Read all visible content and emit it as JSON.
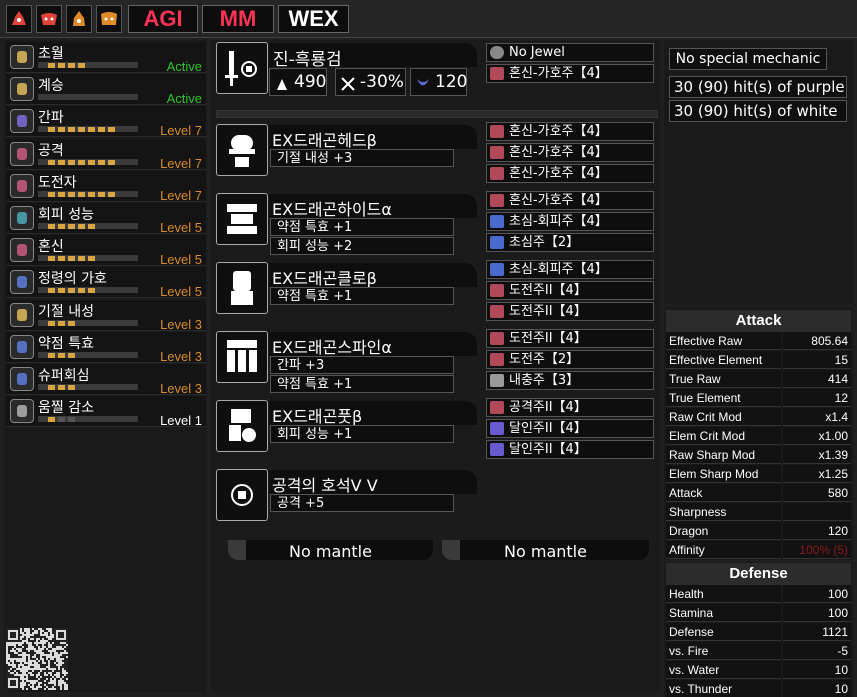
{
  "toolbar": {
    "icons": [
      "monster-icon-1",
      "monster-icon-2",
      "monster-icon-3",
      "monster-icon-4"
    ],
    "agi": "AGI",
    "mm": "MM",
    "wex": "WEX"
  },
  "skills": [
    {
      "name": "초월",
      "status": "Active",
      "pips": 4,
      "max": 4,
      "type": "active",
      "color": "#d6b25a"
    },
    {
      "name": "계승",
      "status": "Active",
      "pips": 0,
      "max": 0,
      "type": "active",
      "color": "#d6b25a"
    },
    {
      "name": "간파",
      "status": "Level 7",
      "pips": 7,
      "max": 7,
      "type": "lv",
      "color": "#7a6ad0"
    },
    {
      "name": "공격",
      "status": "Level 7",
      "pips": 7,
      "max": 7,
      "type": "lv",
      "color": "#c05a7a"
    },
    {
      "name": "도전자",
      "status": "Level 7",
      "pips": 7,
      "max": 7,
      "type": "lv",
      "color": "#c05a7a"
    },
    {
      "name": "회피 성능",
      "status": "Level 5",
      "pips": 5,
      "max": 5,
      "type": "lv",
      "color": "#4aa0b0"
    },
    {
      "name": "혼신",
      "status": "Level 5",
      "pips": 5,
      "max": 5,
      "type": "lv",
      "color": "#c05a7a"
    },
    {
      "name": "정령의 가호",
      "status": "Level 5",
      "pips": 5,
      "max": 5,
      "type": "lv",
      "color": "#5a7ad0"
    },
    {
      "name": "기절 내성",
      "status": "Level 3",
      "pips": 3,
      "max": 3,
      "type": "lv",
      "color": "#d6b25a"
    },
    {
      "name": "약점 특효",
      "status": "Level 3",
      "pips": 3,
      "max": 3,
      "type": "lv",
      "color": "#5a7ad0"
    },
    {
      "name": "슈퍼회심",
      "status": "Level 3",
      "pips": 3,
      "max": 3,
      "type": "lv",
      "color": "#5a7ad0"
    },
    {
      "name": "움찔 감소",
      "status": "Level 1",
      "pips": 1,
      "max": 3,
      "type": "white",
      "color": "#aaaaaa"
    }
  ],
  "weapon": {
    "name": "진-흑룡검",
    "attack": "490",
    "affinity": "-30%",
    "element": "120",
    "decos": [
      "No Jewel",
      "혼신-가호주【4】"
    ]
  },
  "armor": [
    {
      "name": "EX드래곤헤드β",
      "skills": [
        "기절 내성 +3"
      ],
      "decos": [
        "혼신-가호주【4】",
        "혼신-가호주【4】",
        "혼신-가호주【4】"
      ]
    },
    {
      "name": "EX드래곤하이드α",
      "skills": [
        "약점 특효 +1",
        "회피 성능 +2"
      ],
      "decos": [
        "혼신-가호주【4】",
        "초심-회피주【4】",
        "초심주【2】"
      ]
    },
    {
      "name": "EX드래곤클로β",
      "skills": [
        "약점 특효 +1"
      ],
      "decos": [
        "초심-회피주【4】",
        "도전주II【4】",
        "도전주II【4】"
      ]
    },
    {
      "name": "EX드래곤스파인α",
      "skills": [
        "간파 +3",
        "약점 특효 +1"
      ],
      "decos": [
        "도전주II【4】",
        "도전주【2】",
        "내충주【3】"
      ]
    },
    {
      "name": "EX드래곤풋β",
      "skills": [
        "회피 성능 +1"
      ],
      "decos": [
        "공격주II【4】",
        "달인주II【4】",
        "달인주II【4】"
      ]
    },
    {
      "name": "공격의 호석V V",
      "skills": [
        "공격 +5"
      ],
      "decos": []
    }
  ],
  "mantles": [
    "No mantle",
    "No mantle"
  ],
  "right": {
    "mechanic": "No special mechanic",
    "purple": "30 (90) hit(s) of purple",
    "white": "30 (90) hit(s) of white"
  },
  "attack": {
    "title": "Attack",
    "rows": [
      {
        "label": "Effective Raw",
        "value": "805.64"
      },
      {
        "label": "Effective Element",
        "value": "15"
      },
      {
        "label": "True Raw",
        "value": "414"
      },
      {
        "label": "True Element",
        "value": "12"
      },
      {
        "label": "Raw Crit Mod",
        "value": "x1.4"
      },
      {
        "label": "Elem Crit Mod",
        "value": "x1.00"
      },
      {
        "label": "Raw Sharp Mod",
        "value": "x1.39"
      },
      {
        "label": "Elem Sharp Mod",
        "value": "x1.25"
      },
      {
        "label": "Attack",
        "value": "580"
      },
      {
        "label": "Sharpness",
        "value": ""
      },
      {
        "label": "Dragon",
        "value": "120"
      },
      {
        "label": "Affinity",
        "value": "100% (5)"
      }
    ]
  },
  "defense": {
    "title": "Defense",
    "rows": [
      {
        "label": "Health",
        "value": "100"
      },
      {
        "label": "Stamina",
        "value": "100"
      },
      {
        "label": "Defense",
        "value": "1121"
      },
      {
        "label": "vs. Fire",
        "value": "-5"
      },
      {
        "label": "vs. Water",
        "value": "10"
      },
      {
        "label": "vs. Thunder",
        "value": "10"
      }
    ]
  },
  "colors": {
    "agi": "#ff3355",
    "mm": "#ff3355",
    "wex": "#ffffff",
    "active": "#2ec42e",
    "level": "#d98c2b",
    "affinity": "#8b1a1a",
    "sharp_purple": "#a020a0"
  }
}
